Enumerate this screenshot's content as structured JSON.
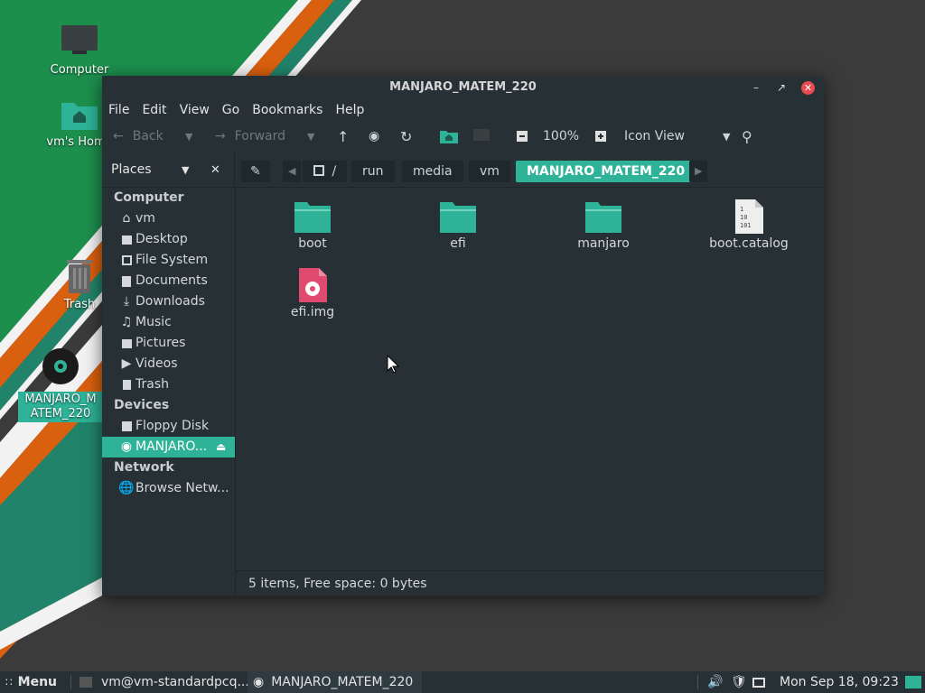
{
  "desktop": {
    "icons": [
      {
        "label": "Computer"
      },
      {
        "label": "vm's Home"
      },
      {
        "label": "Trash"
      },
      {
        "label": "MANJARO_MATEM_220"
      }
    ]
  },
  "window": {
    "title": "MANJARO_MATEM_220",
    "menu": [
      "File",
      "Edit",
      "View",
      "Go",
      "Bookmarks",
      "Help"
    ],
    "toolbar": {
      "back": "Back",
      "forward": "Forward",
      "zoom": "100%",
      "view_mode": "Icon View"
    },
    "places_label": "Places",
    "breadcrumbs": [
      "/",
      "run",
      "media",
      "vm",
      "MANJARO_MATEM_220"
    ],
    "sidebar": {
      "computer_header": "Computer",
      "computer_items": [
        "vm",
        "Desktop",
        "File System",
        "Documents",
        "Downloads",
        "Music",
        "Pictures",
        "Videos",
        "Trash"
      ],
      "devices_header": "Devices",
      "devices_items": [
        "Floppy Disk",
        "MANJARO..."
      ],
      "network_header": "Network",
      "network_items": [
        "Browse Netw..."
      ]
    },
    "files": [
      {
        "name": "boot",
        "type": "folder"
      },
      {
        "name": "efi",
        "type": "folder"
      },
      {
        "name": "manjaro",
        "type": "folder"
      },
      {
        "name": "boot.catalog",
        "type": "binary"
      },
      {
        "name": "efi.img",
        "type": "disk-image"
      }
    ],
    "status": "5 items, Free space: 0 bytes"
  },
  "taskbar": {
    "menu_label": "Menu",
    "tasks": [
      "vm@vm-standardpcq...",
      "MANJARO_MATEM_220"
    ],
    "clock": "Mon Sep 18, 09:23"
  },
  "colors": {
    "accent": "#2eb398",
    "close": "#e84a4f",
    "panel": "#263035"
  }
}
